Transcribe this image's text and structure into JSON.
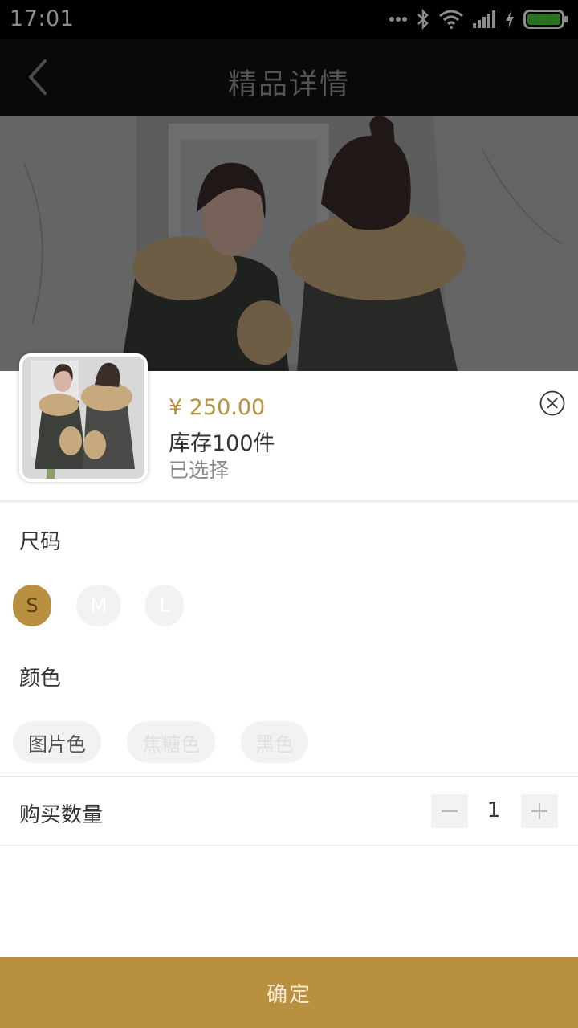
{
  "status_bar": {
    "time": "17:01",
    "icons": [
      "more-dots-icon",
      "bluetooth-icon",
      "wifi-icon",
      "signal-icon",
      "charging-icon",
      "battery-icon"
    ]
  },
  "header": {
    "title": "精品详情",
    "back_icon": "chevron-left-icon"
  },
  "product": {
    "price": "¥ 250.00",
    "stock": "库存100件",
    "selected_label": "已选择"
  },
  "size": {
    "label": "尺码",
    "options": [
      "S",
      "M",
      "L"
    ],
    "selected": "S"
  },
  "color": {
    "label": "颜色",
    "options": [
      "图片色",
      "焦糖色",
      "黑色"
    ],
    "selected": "图片色"
  },
  "quantity": {
    "label": "购买数量",
    "value": "1"
  },
  "confirm_label": "确定",
  "colors": {
    "accent": "#b8903f",
    "header_bg": "#111111",
    "chip_bg": "#f2f2f2"
  }
}
